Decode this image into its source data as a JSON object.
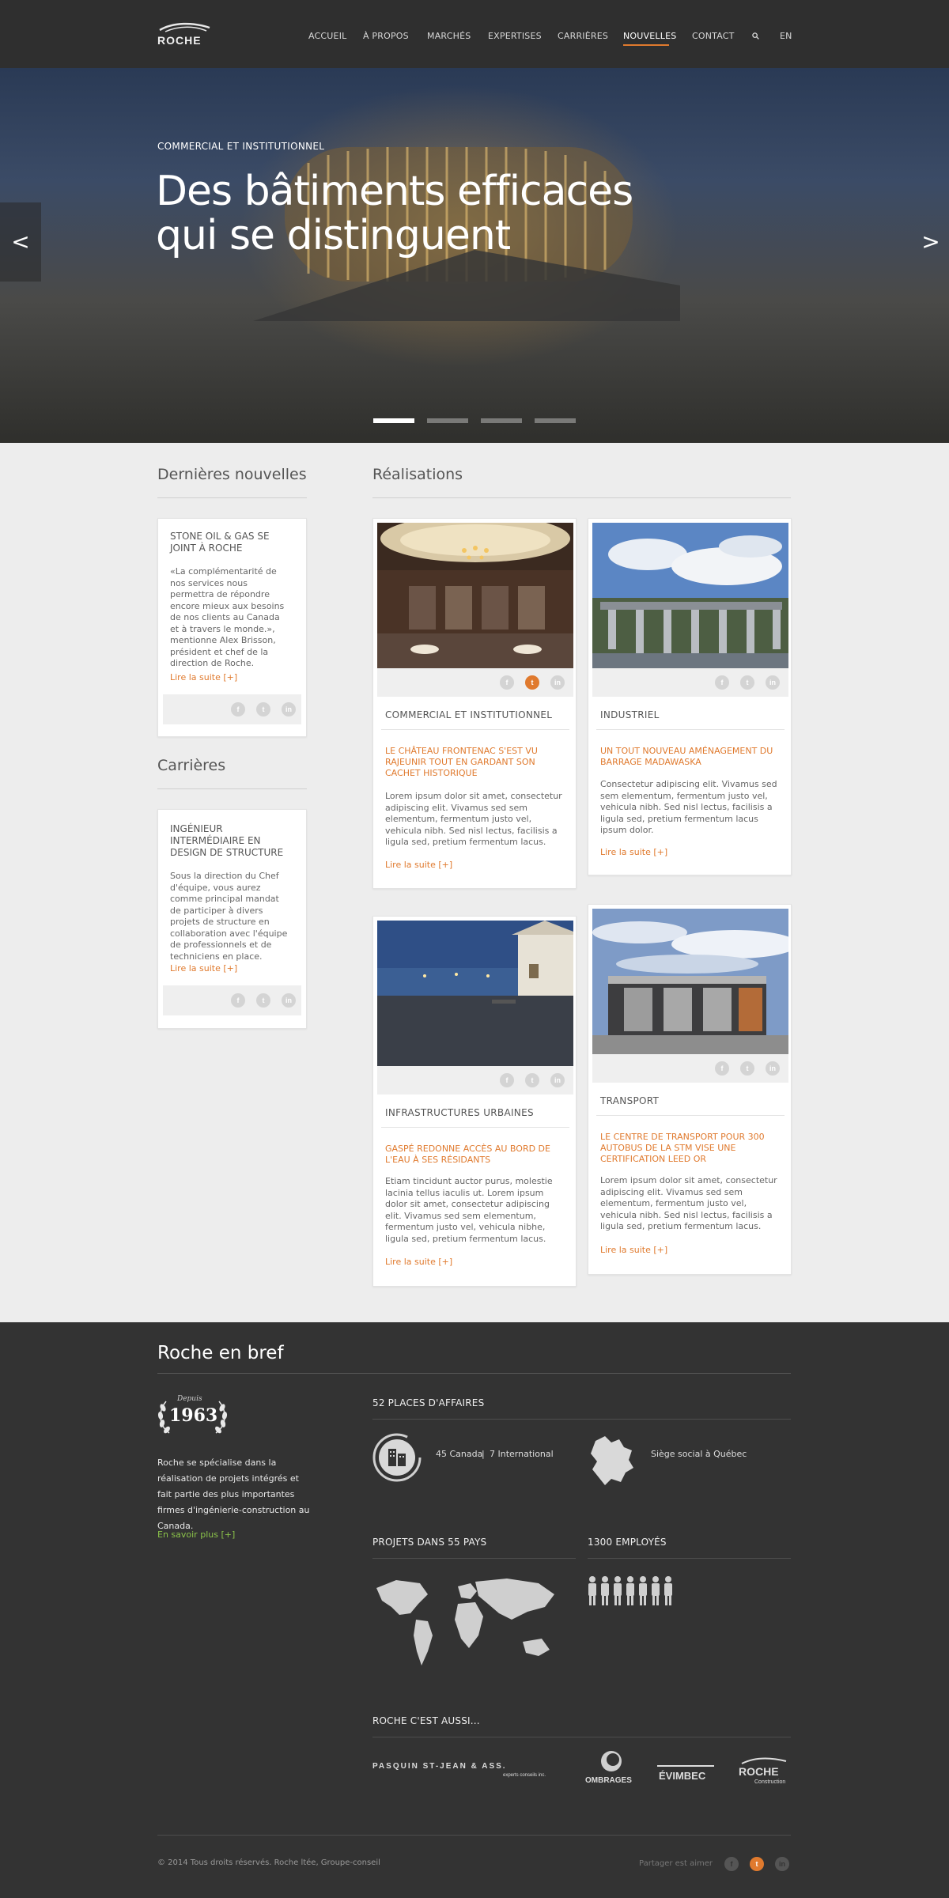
{
  "header": {
    "logo_text": "ROCHE",
    "nav": [
      "ACCUEIL",
      "À PROPOS",
      "MARCHÉS",
      "EXPERTISES",
      "CARRIÈRES",
      "NOUVELLES",
      "CONTACT"
    ],
    "active_nav": "NOUVELLES",
    "lang": "EN",
    "accent": "#e07a2e"
  },
  "hero": {
    "kicker": "COMMERCIAL ET INSTITUTIONNEL",
    "title_line1": "Des bâtiments efficaces",
    "title_line2": "qui se distinguent",
    "prev": "<",
    "next": ">",
    "slides": 4,
    "active_slide": 1
  },
  "news": {
    "title": "Dernières nouvelles",
    "card": {
      "title": "STONE OIL & GAS SE JOINT À ROCHE",
      "text": "«La complémentarité de nos services nous permettra de répondre encore mieux aux besoins de nos clients au Canada et à travers le monde.», mentionne Alex Brisson, président et chef de la direction de Roche.",
      "read_more": "Lire la suite [+]"
    }
  },
  "careers": {
    "title": "Carrières",
    "card": {
      "title": "INGÉNIEUR INTERMÉDIAIRE EN DESIGN DE STRUCTURE",
      "text": "Sous la direction du Chef d'équipe, vous aurez comme principal mandat de participer à divers projets de structure en collaboration avec l'équipe de professionnels et de techniciens en place.",
      "read_more": "Lire la suite [+]"
    }
  },
  "realisations": {
    "title": "Réalisations",
    "cards": [
      {
        "category": "COMMERCIAL ET INSTITUTIONNEL",
        "headline": "LE CHÂTEAU FRONTENAC S'EST VU RAJEUNIR TOUT EN GARDANT SON CACHET HISTORIQUE",
        "text": "Lorem ipsum dolor sit amet, consectetur adipiscing elit. Vivamus sed sem elementum, fermentum justo vel, vehicula nibh. Sed nisl lectus, facilisis a ligula sed, pretium fermentum lacus.",
        "read_more": "Lire la suite [+]"
      },
      {
        "category": "INDUSTRIEL",
        "headline": "UN TOUT NOUVEAU AMÉNAGEMENT DU BARRAGE MADAWASKA",
        "text": "Consectetur adipiscing elit. Vivamus sed sem elementum, fermentum justo vel, vehicula nibh. Sed nisl lectus, facilisis a ligula sed, pretium fermentum lacus ipsum dolor.",
        "read_more": "Lire la suite [+]"
      },
      {
        "category": "INFRASTRUCTURES URBAINES",
        "headline": "GASPÉ REDONNE ACCÈS AU BORD DE L'EAU À SES RÉSIDANTS",
        "text": "Etiam tincidunt auctor purus, molestie lacinia tellus iaculis ut. Lorem ipsum dolor sit amet, consectetur adipiscing elit. Vivamus sed sem elementum, fermentum justo vel, vehicula nibhe, ligula sed, pretium fermentum lacus.",
        "read_more": "Lire la suite [+]"
      },
      {
        "category": "TRANSPORT",
        "headline": "LE CENTRE DE TRANSPORT POUR 300 AUTOBUS DE LA STM VISE UNE CERTIFICATION LEED OR",
        "text": "Lorem ipsum dolor sit amet, consectetur adipiscing elit. Vivamus sed sem elementum, fermentum justo vel, vehicula nibh. Sed nisl lectus, facilisis a ligula sed, pretium fermentum lacus.",
        "read_more": "Lire la suite [+]"
      }
    ]
  },
  "bref": {
    "title": "Roche en bref",
    "depuis": "Depuis",
    "year": "1963",
    "description": "Roche se spécialise dans la réalisation de projets intégrés et fait partie des plus importantes firmes d'ingénierie-construction au Canada.",
    "more": "En savoir plus [+]",
    "places_title": "52 PLACES D'AFFAIRES",
    "places_canada": "45 Canada",
    "places_sep": "|",
    "places_intl": "7 International",
    "hq": "Siège social à Québec",
    "countries_title": "PROJETS DANS 55 PAYS",
    "employees_title": "1300 EMPLOYÉS",
    "employee_icons": 7,
    "also_title": "ROCHE C'EST AUSSI...",
    "partners": [
      "PASQUIN  ST-JEAN  & ASS.",
      "experts conseils inc.",
      "OMBRAGES",
      "ÉVIMBEC",
      "ROCHE",
      "Construction"
    ]
  },
  "footer": {
    "copyright": "© 2014 Tous droits réservés. Roche ltée, Groupe-conseil",
    "share_label": "Partager est aimer",
    "social": [
      "f",
      "t",
      "in"
    ]
  }
}
